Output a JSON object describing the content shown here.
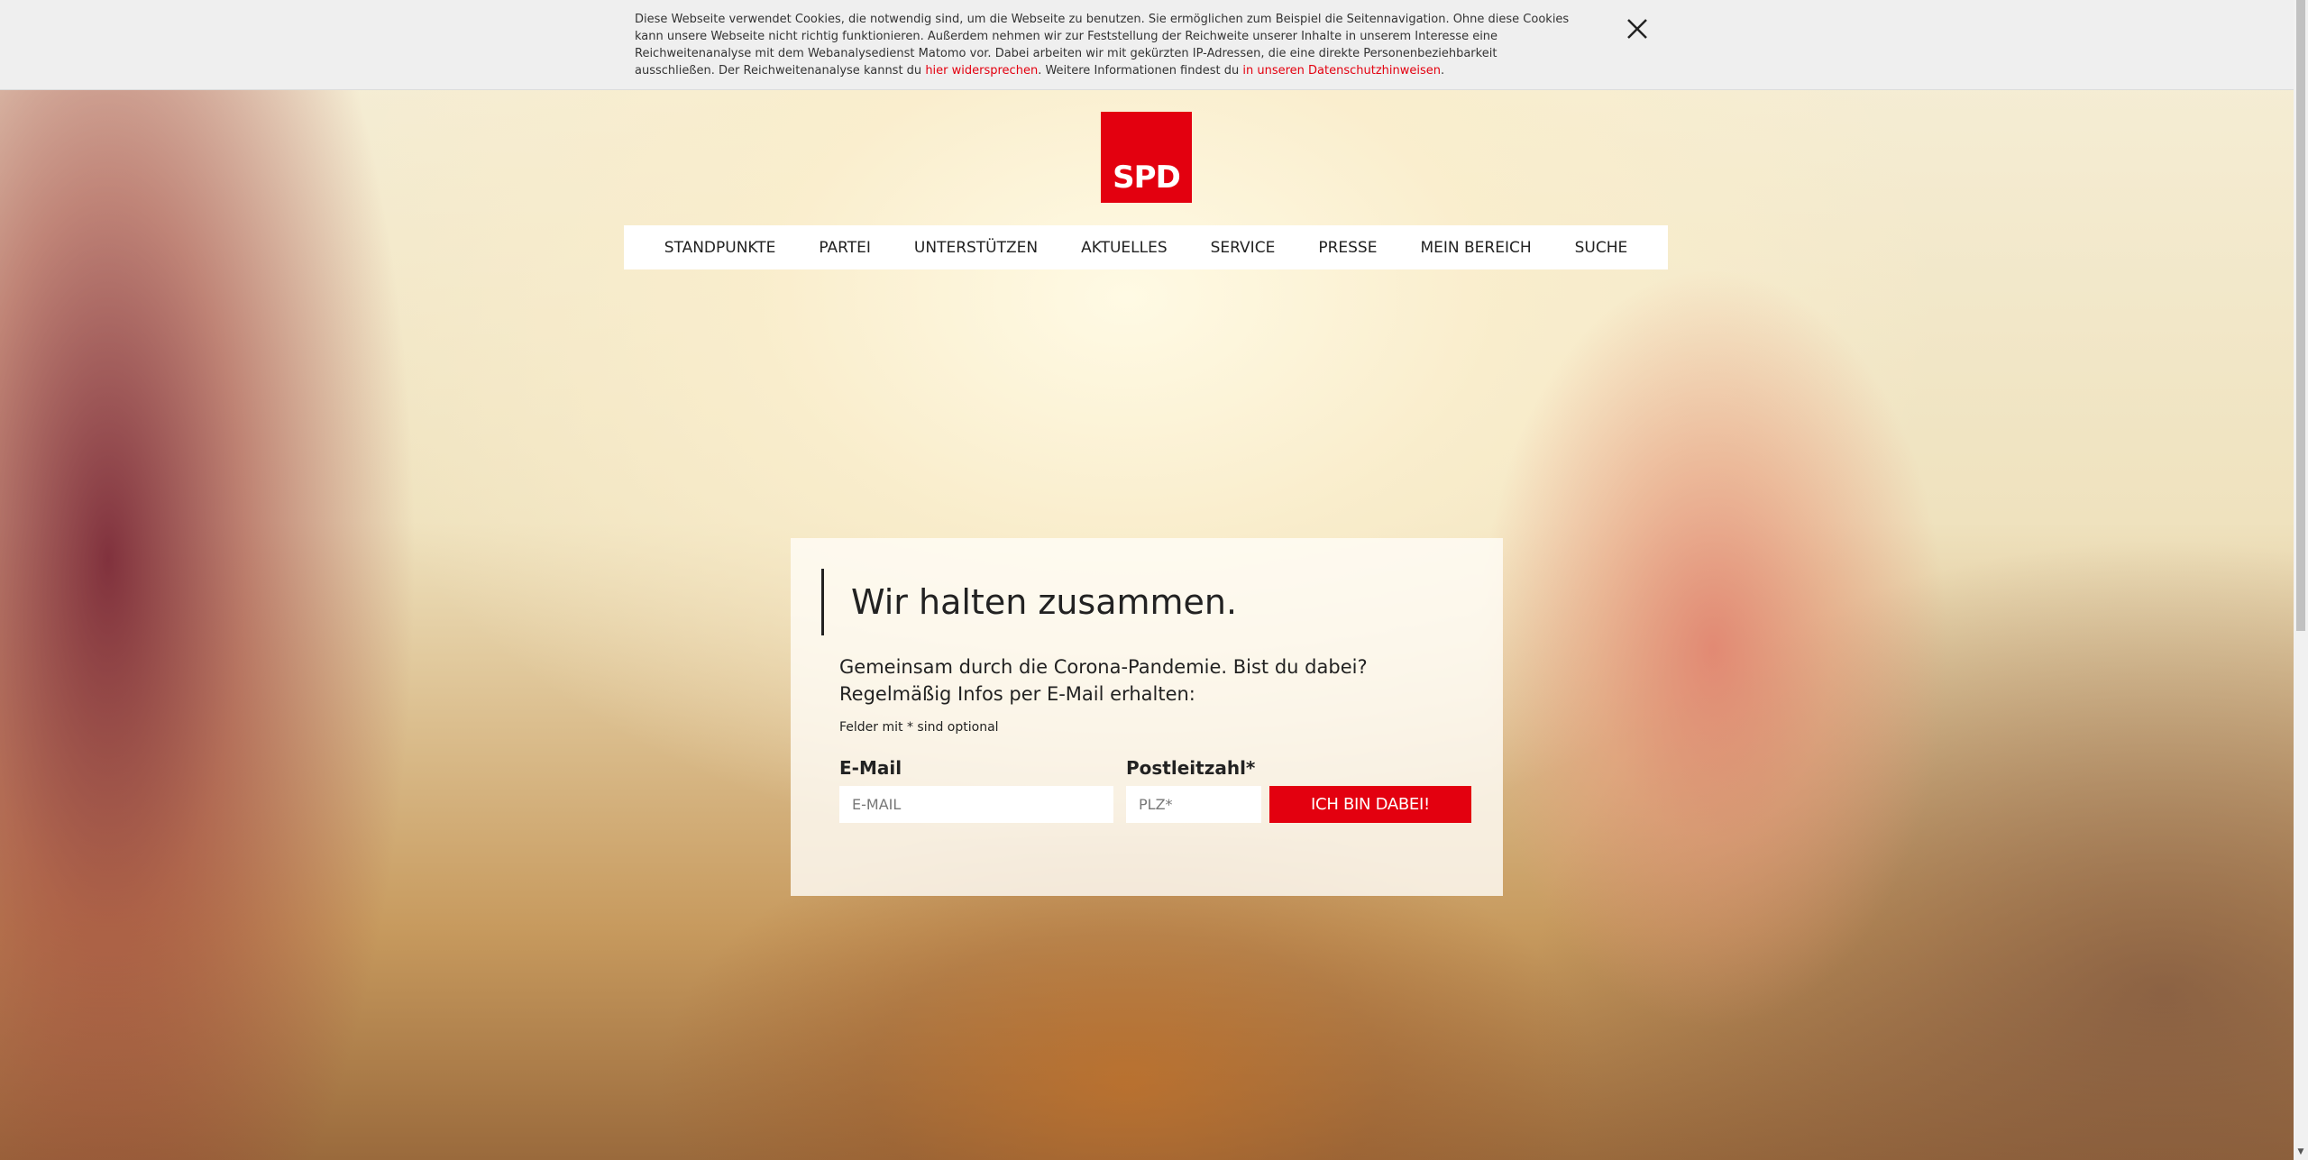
{
  "cookie_banner": {
    "text_before": "Diese Webseite verwendet Cookies, die notwendig sind, um die Webseite zu benutzen. Sie ermöglichen zum Beispiel die Seitennavigation. Ohne diese Cookies kann unsere Webseite nicht richtig funktionieren. Außerdem nehmen wir zur Feststellung der Reichweite unserer Inhalte in unserem Interesse eine Reichweitenanalyse mit dem Webanalysedienst Matomo vor. Dabei arbeiten wir mit gekürzten IP-Adressen, die eine direkte Personenbeziehbarkeit ausschließen. Der Reichweitenanalyse kannst du ",
    "link_object": "hier widersprechen",
    "text_middle": ". Weitere Informationen findest du ",
    "link_privacy": "in unseren Datenschutzhinweisen",
    "text_after": "."
  },
  "logo": {
    "text": "SPD"
  },
  "nav": {
    "items": [
      "STANDPUNKTE",
      "PARTEI",
      "UNTERSTÜTZEN",
      "AKTUELLES",
      "SERVICE",
      "PRESSE",
      "MEIN BEREICH",
      "SUCHE"
    ]
  },
  "form": {
    "headline": "Wir halten zusammen.",
    "intro": "Gemeinsam durch die Corona-Pandemie. Bist du dabei? Regelmäßig Infos per E-Mail erhalten:",
    "note": "Felder mit * sind optional",
    "email_label": "E-Mail",
    "email_placeholder": "E-MAIL",
    "zip_label": "Postleitzahl*",
    "zip_placeholder": "PLZ*",
    "submit_label": "ICH BIN DABEI!"
  },
  "colors": {
    "brand": "#e3000f",
    "cookie_bg": "#efefef"
  },
  "icons": {
    "close": "close-icon"
  }
}
